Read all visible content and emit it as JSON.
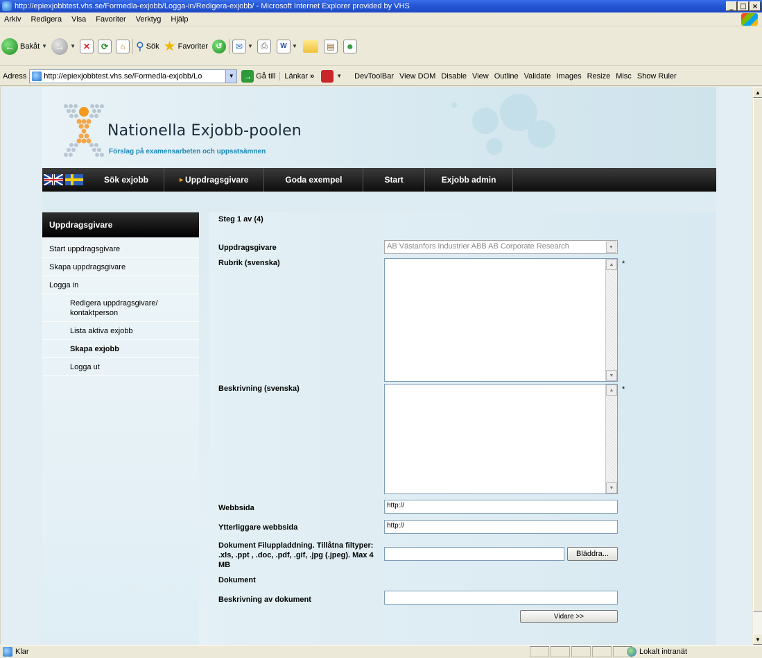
{
  "window": {
    "title": "http://epiexjobbtest.vhs.se/Formedla-exjobb/Logga-in/Redigera-exjobb/ - Microsoft Internet Explorer provided by VHS",
    "controls": [
      "_",
      "□",
      "×"
    ]
  },
  "menu": {
    "items": [
      {
        "label": "Arkiv"
      },
      {
        "label": "Redigera"
      },
      {
        "label": "Visa"
      },
      {
        "label": "Favoriter"
      },
      {
        "label": "Verktyg"
      },
      {
        "label": "Hjälp"
      }
    ]
  },
  "toolbar": {
    "back": "Bakåt",
    "search": "Sök",
    "favorites": "Favoriter"
  },
  "address": {
    "label": "Adress",
    "url": "http://epiexjobbtest.vhs.se/Formedla-exjobb/Lo",
    "go": "Gå till",
    "links": "Länkar",
    "links_more": "»",
    "devtools": [
      "DevToolBar",
      "View DOM",
      "Disable",
      "View",
      "Outline",
      "Validate",
      "Images",
      "Resize",
      "Misc",
      "Show Ruler"
    ]
  },
  "site": {
    "title": "Nationella Exjobb-poolen",
    "tagline": "Förslag på examensarbeten och uppsatsämnen",
    "nav": [
      "Sök exjobb",
      "Uppdragsgivare",
      "Goda exempel",
      "Start",
      "Exjobb admin"
    ]
  },
  "sidebar": {
    "heading": "Uppdragsgivare",
    "items": [
      "Start uppdragsgivare",
      "Skapa uppdragsgivare",
      "Logga in",
      "Redigera uppdragsgivare/ kontaktperson",
      "Lista aktiva exjobb",
      "Skapa exjobb",
      "Logga ut"
    ]
  },
  "form": {
    "step": "Steg 1 av (4)",
    "client_label": "Uppdragsgivare",
    "client_value": "AB Västanfors Industrier ABB AB Corporate Research",
    "heading_label": "Rubrik (svenska)",
    "desc_label": "Beskrivning (svenska)",
    "required_mark": "*",
    "web_label": "Webbsida",
    "web_value": "http://",
    "web2_label": "Ytterliggare webbsida",
    "web2_value": "http://",
    "doc_upload_label": "Dokument Filuppladdning. Tillåtna filtyper: .xls, .ppt , .doc, .pdf, .gif, .jpg (.jpeg). Max 4 MB",
    "browse_button": "Bläddra...",
    "doc_label": "Dokument",
    "doc_desc_label": "Beskrivning av dokument",
    "next_button": "Vidare >>"
  },
  "status": {
    "text": "Klar",
    "zone": "Lokalt intranät"
  }
}
